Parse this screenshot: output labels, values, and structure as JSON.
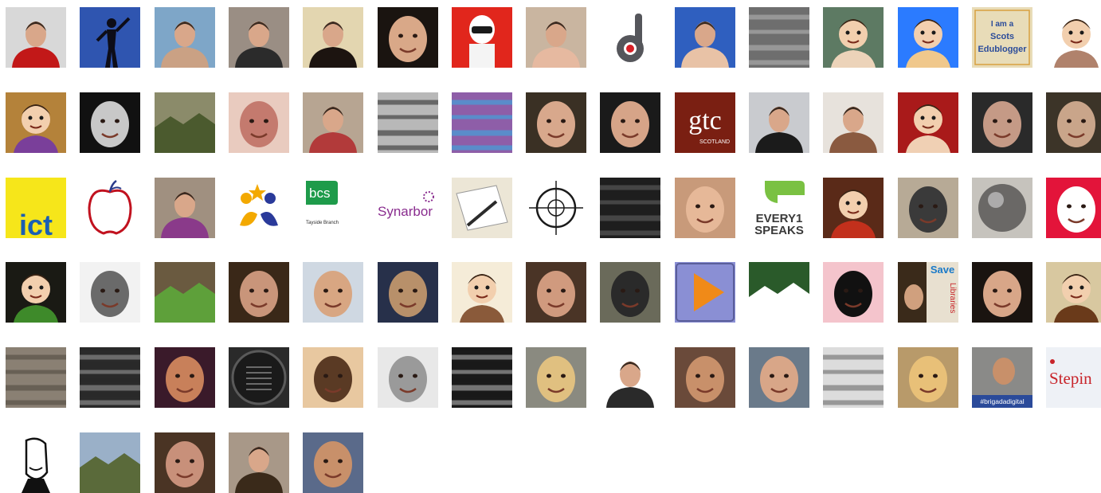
{
  "avatars": [
    {
      "icon": "person-red-jacket-icon",
      "bg": "#d8d8d8",
      "fg": "#c21818",
      "kind": "person"
    },
    {
      "icon": "silhouette-icon",
      "bg": "#2f55b0",
      "fg": "#0d0d18",
      "kind": "silhouette"
    },
    {
      "icon": "bald-man-icon",
      "bg": "#7ea6c8",
      "fg": "#caa184",
      "kind": "person"
    },
    {
      "icon": "man-with-baby-icon",
      "bg": "#9a8e84",
      "fg": "#2b2b2b",
      "kind": "person"
    },
    {
      "icon": "woman-dark-hair-icon",
      "bg": "#e3d6b0",
      "fg": "#1c1410",
      "kind": "person"
    },
    {
      "icon": "woman-smiling-icon",
      "bg": "#1a1410",
      "fg": "#d9a888",
      "kind": "face"
    },
    {
      "icon": "lego-stig-icon",
      "bg": "#e1261c",
      "fg": "#ffffff",
      "kind": "lego"
    },
    {
      "icon": "woman-flower-icon",
      "bg": "#c9b5a0",
      "fg": "#e6b9a0",
      "kind": "person"
    },
    {
      "icon": "letter-d-logo-icon",
      "bg": "#ffffff",
      "fg": "#55565b",
      "kind": "dlogo"
    },
    {
      "icon": "man-blue-background-icon",
      "bg": "#2f5fbf",
      "fg": "#e8c2a6",
      "kind": "person"
    },
    {
      "icon": "grey-abstract-icon",
      "bg": "#6e6e6e",
      "fg": "#a8a8a8",
      "kind": "abstract"
    },
    {
      "icon": "cartoon-mustache-icon",
      "bg": "#5d7a63",
      "fg": "#ecd3b9",
      "kind": "cartoon"
    },
    {
      "icon": "mii-avatar-icon",
      "bg": "#2b7bff",
      "fg": "#f0c88c",
      "kind": "cartoon"
    },
    {
      "icon": "scots-edublogger-badge-icon",
      "bg": "#e8dcb8",
      "fg": "#2b4c9a",
      "kind": "badge",
      "badge_text": [
        "I am a",
        "Scots",
        "Edublogger"
      ]
    },
    {
      "icon": "bearded-man-cartoon-icon",
      "bg": "#ffffff",
      "fg": "#b0826c",
      "kind": "cartoon"
    },
    {
      "icon": "cartoon-girl-icon",
      "bg": "#b4823a",
      "fg": "#7a3f9a",
      "kind": "cartoon"
    },
    {
      "icon": "joker-icon",
      "bg": "#111111",
      "fg": "#c8c8c8",
      "kind": "face"
    },
    {
      "icon": "landscape-clouds-icon",
      "bg": "#8b8b6a",
      "fg": "#4b5a2e",
      "kind": "landscape"
    },
    {
      "icon": "woman-selfie-icon",
      "bg": "#e9cbbf",
      "fg": "#c47a6e",
      "kind": "face"
    },
    {
      "icon": "woman-blonde-red-icon",
      "bg": "#b7a592",
      "fg": "#b23a3a",
      "kind": "person"
    },
    {
      "icon": "mixing-desk-icon",
      "bg": "#b8b8b8",
      "fg": "#444444",
      "kind": "abstract"
    },
    {
      "icon": "screenshot-collage-icon",
      "bg": "#8e5ea8",
      "fg": "#44a0d8",
      "kind": "abstract"
    },
    {
      "icon": "man-glasses-smiling-icon",
      "bg": "#3a3024",
      "fg": "#d8a88c",
      "kind": "face"
    },
    {
      "icon": "woman-green-top-icon",
      "bg": "#1a1a1a",
      "fg": "#d6a488",
      "kind": "face"
    },
    {
      "icon": "gtc-scotland-logo-icon",
      "bg": "#7a1f12",
      "fg": "#ffffff",
      "kind": "gtc",
      "logo_text": "gtc",
      "logo_sub": "SCOTLAND"
    },
    {
      "icon": "man-yellow-tie-icon",
      "bg": "#c9cbcf",
      "fg": "#1b1b1b",
      "kind": "person"
    },
    {
      "icon": "woman-brown-hair-icon",
      "bg": "#e7e2dc",
      "fg": "#8a5a40",
      "kind": "person"
    },
    {
      "icon": "cartoon-boy-red-icon",
      "bg": "#a91a1a",
      "fg": "#f0d0b4",
      "kind": "cartoon"
    },
    {
      "icon": "man-grey-hair-icon",
      "bg": "#2a2a2a",
      "fg": "#c59a86",
      "kind": "face"
    },
    {
      "icon": "man-curly-hair-icon",
      "bg": "#3c3428",
      "fg": "#c9a58a",
      "kind": "face"
    },
    {
      "icon": "ict-logo-icon",
      "bg": "#f6e61a",
      "fg": "#1a5fb3",
      "kind": "ict",
      "logo_text": "ict"
    },
    {
      "icon": "apple-outline-icon",
      "bg": "#ffffff",
      "fg": "#c1121f",
      "kind": "apple"
    },
    {
      "icon": "woman-purple-icon",
      "bg": "#a09080",
      "fg": "#8a3a8a",
      "kind": "person"
    },
    {
      "icon": "children-stars-logo-icon",
      "bg": "#ffffff",
      "fg": "#f3a900",
      "kind": "stars"
    },
    {
      "icon": "bcs-tayside-logo-icon",
      "bg": "#ffffff",
      "fg": "#1e9b4a",
      "kind": "bcs",
      "logo_text": "bcs",
      "logo_sub": "Tayside Branch"
    },
    {
      "icon": "synarbor-logo-icon",
      "bg": "#ffffff",
      "fg": "#8a2d8f",
      "kind": "synarbor",
      "logo_text": "Synarbor"
    },
    {
      "icon": "pen-notebook-icon",
      "bg": "#ece6d6",
      "fg": "#2b2b2b",
      "kind": "pen"
    },
    {
      "icon": "crosshair-icon",
      "bg": "#ffffff",
      "fg": "#1a1a1a",
      "kind": "crosshair"
    },
    {
      "icon": "dark-blur-icon",
      "bg": "#1e1e1e",
      "fg": "#555555",
      "kind": "abstract"
    },
    {
      "icon": "woman-closeup-icon",
      "bg": "#c89a7a",
      "fg": "#e6b898",
      "kind": "face"
    },
    {
      "icon": "every1-speaks-logo-icon",
      "bg": "#ffffff",
      "fg": "#7ac142",
      "kind": "every1",
      "logo_text": [
        "EVERY1",
        "SPEAKS"
      ]
    },
    {
      "icon": "animal-muppet-icon",
      "bg": "#5a2a18",
      "fg": "#c2301c",
      "kind": "cartoon"
    },
    {
      "icon": "man-glasses-selfie-icon",
      "bg": "#b7aa96",
      "fg": "#3a3a3a",
      "kind": "face"
    },
    {
      "icon": "crystal-ball-icon",
      "bg": "#c6c3bd",
      "fg": "#6a6866",
      "kind": "ball"
    },
    {
      "icon": "red-portrait-icon",
      "bg": "#e3143a",
      "fg": "#ffffff",
      "kind": "face"
    },
    {
      "icon": "green-hat-figure-icon",
      "bg": "#1a1a14",
      "fg": "#3e8a2a",
      "kind": "cartoon"
    },
    {
      "icon": "man-bald-grey-icon",
      "bg": "#f2f2f2",
      "fg": "#6a6a6a",
      "kind": "face"
    },
    {
      "icon": "plant-leaves-icon",
      "bg": "#6a5a40",
      "fg": "#5ea03a",
      "kind": "landscape"
    },
    {
      "icon": "man-glasses-beard-icon",
      "bg": "#3a2818",
      "fg": "#c9957a",
      "kind": "face"
    },
    {
      "icon": "man-blonde-blue-icon",
      "bg": "#cfd8e2",
      "fg": "#d8a682",
      "kind": "face"
    },
    {
      "icon": "man-night-sky-icon",
      "bg": "#27304a",
      "fg": "#b8906a",
      "kind": "face"
    },
    {
      "icon": "cartoon-man-happy-icon",
      "bg": "#f5ecd8",
      "fg": "#8a5a3a",
      "kind": "cartoon"
    },
    {
      "icon": "woman-dark-selfie-icon",
      "bg": "#4a3426",
      "fg": "#d09a7e",
      "kind": "face"
    },
    {
      "icon": "man-monitor-icon",
      "bg": "#6a6a5a",
      "fg": "#2a2a2a",
      "kind": "face"
    },
    {
      "icon": "play-button-icon",
      "bg": "#8a8fd4",
      "fg": "#f08a18",
      "kind": "play"
    },
    {
      "icon": "football-player-icon",
      "bg": "#2a5a2a",
      "fg": "#ffffff",
      "kind": "landscape"
    },
    {
      "icon": "woman-sketch-icon",
      "bg": "#f4c4cc",
      "fg": "#111111",
      "kind": "face"
    },
    {
      "icon": "save-libraries-icon",
      "bg": "#3a2a1a",
      "fg": "#1a7ac8",
      "kind": "saves",
      "logo_text": [
        "Save",
        "Libraries"
      ]
    },
    {
      "icon": "woman-dark-hair-smile-icon",
      "bg": "#1a1410",
      "fg": "#d8a688",
      "kind": "face"
    },
    {
      "icon": "cartoon-glasses-man-icon",
      "bg": "#d8c8a0",
      "fg": "#6a3a1a",
      "kind": "cartoon"
    },
    {
      "icon": "wood-carving-icon",
      "bg": "#8a8074",
      "fg": "#5a5248",
      "kind": "abstract"
    },
    {
      "icon": "glitch-dark-icon",
      "bg": "#2a2a2a",
      "fg": "#888888",
      "kind": "abstract"
    },
    {
      "icon": "fisheye-face-icon",
      "bg": "#3a1a2a",
      "fg": "#c8805a",
      "kind": "face"
    },
    {
      "icon": "plaque-icon",
      "bg": "#2a2a2a",
      "fg": "#5a5a5a",
      "kind": "plaque"
    },
    {
      "icon": "woman-laughing-icon",
      "bg": "#e8c8a0",
      "fg": "#5a3a24",
      "kind": "face"
    },
    {
      "icon": "stone-head-icon",
      "bg": "#e8e8e8",
      "fg": "#9a9a9a",
      "kind": "face"
    },
    {
      "icon": "bw-stripes-icon",
      "bg": "#1a1a1a",
      "fg": "#9a9a9a",
      "kind": "abstract"
    },
    {
      "icon": "woman-blonde-bob-icon",
      "bg": "#8a8a80",
      "fg": "#e0c080",
      "kind": "face"
    },
    {
      "icon": "man-bw-desk-icon",
      "bg": "#ffffff",
      "fg": "#2a2a2a",
      "kind": "person"
    },
    {
      "icon": "man-suit-icon",
      "bg": "#6a4a3a",
      "fg": "#c8906a",
      "kind": "face"
    },
    {
      "icon": "bald-man-smiling-icon",
      "bg": "#6a7a8a",
      "fg": "#d8a688",
      "kind": "face"
    },
    {
      "icon": "grey-pixelated-icon",
      "bg": "#dcdcdc",
      "fg": "#7a7a7a",
      "kind": "abstract"
    },
    {
      "icon": "woman-blonde-curly-icon",
      "bg": "#b89a6a",
      "fg": "#e8c078",
      "kind": "face"
    },
    {
      "icon": "brigada-digital-icon",
      "bg": "#8a8a88",
      "fg": "#2a4a9a",
      "kind": "brigada",
      "logo_text": "#brigadadigital"
    },
    {
      "icon": "stepin-logo-icon",
      "bg": "#eef1f6",
      "fg": "#c8242a",
      "kind": "stepin",
      "logo_text": "Stepin"
    },
    {
      "icon": "cartoon-sketch-man-icon",
      "bg": "#ffffff",
      "fg": "#111111",
      "kind": "sketch"
    },
    {
      "icon": "man-hiking-icon",
      "bg": "#9ab0c8",
      "fg": "#5a6a3a",
      "kind": "landscape"
    },
    {
      "icon": "woman-glasses-books-icon",
      "bg": "#4a3424",
      "fg": "#c8907a",
      "kind": "face"
    },
    {
      "icon": "woman-cafe-icon",
      "bg": "#a89888",
      "fg": "#3a2a1a",
      "kind": "person"
    },
    {
      "icon": "man-sunglasses-icon",
      "bg": "#5a6a8a",
      "fg": "#c8906a",
      "kind": "face"
    }
  ]
}
